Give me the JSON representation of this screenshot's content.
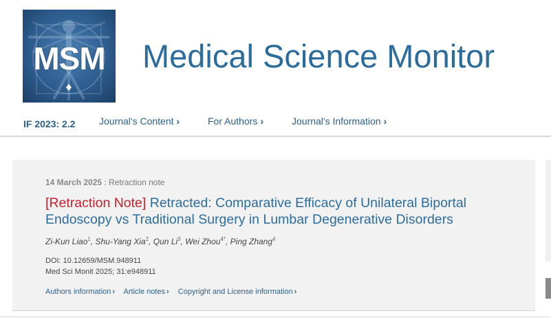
{
  "header": {
    "logo_text": "MSM",
    "journal_title": "Medical Science Monitor"
  },
  "nav": {
    "impact_factor": "IF 2023: 2.2",
    "items": [
      {
        "label": "Journal's Content"
      },
      {
        "label": "For Authors"
      },
      {
        "label": "Journal's Information"
      }
    ]
  },
  "article": {
    "date": "14 March 2025",
    "type": ": Retraction note",
    "tag": "[Retraction Note]",
    "title": "Retracted: Comparative Efficacy of Unilateral Biportal Endoscopy vs Traditional Surgery in Lumbar Degenerative Disorders",
    "authors": [
      {
        "name": "Zi-Kun Liao",
        "sup": "1"
      },
      {
        "name": "Shu-Yang Xia",
        "sup": "2"
      },
      {
        "name": "Qun Li",
        "sup": "3"
      },
      {
        "name": "Wei Zhou",
        "sup": "4*"
      },
      {
        "name": "Ping Zhang",
        "sup": "4"
      }
    ],
    "doi": "DOI: 10.12659/MSM.948911",
    "citation": "Med Sci Monit 2025; 31:e948911",
    "links": [
      {
        "label": "Authors information"
      },
      {
        "label": "Article notes"
      },
      {
        "label": "Copyright and License information"
      }
    ]
  },
  "colors": {
    "brand": "#2c6c9c",
    "nav_link": "#2c5f8a",
    "retraction_tag": "#c8202f",
    "card_bg": "#f2f2f2"
  },
  "icons": [
    "chevron-right-icon",
    "vitruvian-man-logo"
  ]
}
